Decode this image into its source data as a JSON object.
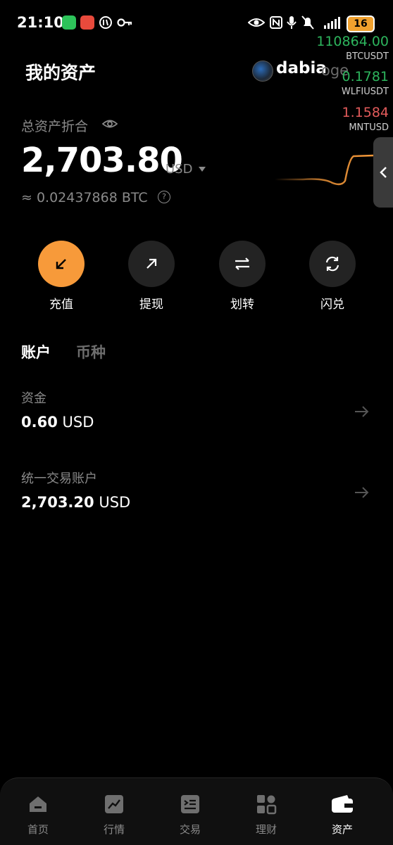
{
  "status_bar": {
    "time": "21:10",
    "battery": "16",
    "icons": [
      "wechat-icon",
      "notification-icon",
      "vpn-icon",
      "key-icon",
      "eye-icon",
      "nfc-icon",
      "mic-icon",
      "mute-icon",
      "signal-icon",
      "battery-icon"
    ]
  },
  "header": {
    "title": "我的资产",
    "username": "dabia",
    "username_overlap": "oge"
  },
  "tickers": [
    {
      "price": "110864.00",
      "symbol": "BTCUSDT",
      "color": "#2db55d"
    },
    {
      "price": "0.1781",
      "symbol": "WLFIUSDT",
      "color": "#2db55d"
    },
    {
      "price": "1.1584",
      "symbol": "MNTUSD",
      "color": "#e35b5b"
    }
  ],
  "summary": {
    "label": "总资产折合",
    "total": "2,703.80",
    "unit": "USD",
    "btc": "≈ 0.02437868 BTC",
    "help": "?"
  },
  "actions": [
    {
      "label": "充值",
      "icon": "deposit-arrow-icon",
      "color": "#f79a3a"
    },
    {
      "label": "提现",
      "icon": "withdraw-arrow-icon"
    },
    {
      "label": "划转",
      "icon": "transfer-icon"
    },
    {
      "label": "闪兑",
      "icon": "convert-icon"
    }
  ],
  "tabs": {
    "account": "账户",
    "currency": "币种"
  },
  "accounts": [
    {
      "name": "资金",
      "amount": "0.60",
      "unit": "USD"
    },
    {
      "name": "统一交易账户",
      "amount": "2,703.20",
      "unit": "USD"
    }
  ],
  "nav": [
    {
      "label": "首页",
      "icon": "home-icon"
    },
    {
      "label": "行情",
      "icon": "market-chart-icon"
    },
    {
      "label": "交易",
      "icon": "trade-icon"
    },
    {
      "label": "理财",
      "icon": "earn-icon"
    },
    {
      "label": "资产",
      "icon": "wallet-icon",
      "active": true
    }
  ],
  "colors": {
    "accent": "#f79a3a",
    "up": "#2db55d",
    "down": "#e35b5b"
  }
}
